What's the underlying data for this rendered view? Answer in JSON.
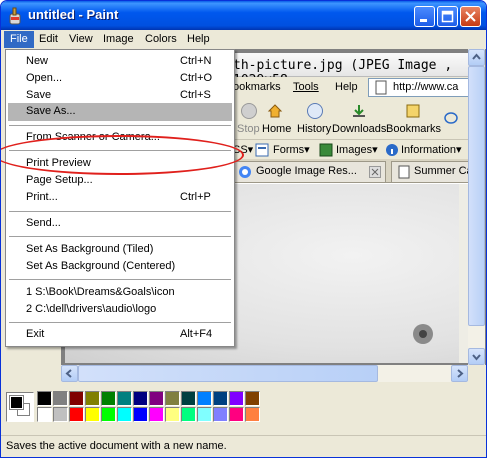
{
  "window": {
    "title": "untitled - Paint"
  },
  "menubar": [
    "File",
    "Edit",
    "View",
    "Image",
    "Colors",
    "Help"
  ],
  "file_menu": {
    "items": [
      {
        "label": "New",
        "shortcut": "Ctrl+N"
      },
      {
        "label": "Open...",
        "shortcut": "Ctrl+O"
      },
      {
        "label": "Save",
        "shortcut": "Ctrl+S"
      },
      {
        "label": "Save As...",
        "shortcut": ""
      },
      {
        "label": "From Scanner or Camera...",
        "shortcut": ""
      },
      {
        "label": "Print Preview",
        "shortcut": ""
      },
      {
        "label": "Page Setup...",
        "shortcut": ""
      },
      {
        "label": "Print...",
        "shortcut": "Ctrl+P"
      },
      {
        "label": "Send...",
        "shortcut": ""
      },
      {
        "label": "Set As Background (Tiled)",
        "shortcut": ""
      },
      {
        "label": "Set As Background (Centered)",
        "shortcut": ""
      },
      {
        "label": "1 S:\\Book\\Dreams&Goals\\icon",
        "shortcut": ""
      },
      {
        "label": "2 C:\\dell\\drivers\\audio\\logo",
        "shortcut": ""
      },
      {
        "label": "Exit",
        "shortcut": "Alt+F4"
      }
    ],
    "highlighted": "Save As..."
  },
  "picture": {
    "title": "th-picture.jpg (JPEG Image , 1029x58",
    "menu": {
      "bookmarks": "ookmarks",
      "tools": "Tools",
      "help": "Help"
    },
    "url": "http://www.ca",
    "toolbar": {
      "stop": "Stop",
      "home": "Home",
      "history": "History",
      "downloads": "Downloads",
      "bookmarks": "Bookmarks"
    },
    "extras": {
      "ss": "SS▾",
      "forms": "Forms▾",
      "images": "Images▾",
      "information": "Information▾"
    },
    "tabs": [
      "Google Image Res...",
      "Summer Ca"
    ]
  },
  "palette": {
    "top_row": [
      "#000000",
      "#808080",
      "#800000",
      "#808000",
      "#008000",
      "#008080",
      "#000080",
      "#800080",
      "#808040",
      "#004040",
      "#0080ff",
      "#004080",
      "#8000ff",
      "#804000"
    ],
    "bottom_row": [
      "#ffffff",
      "#c0c0c0",
      "#ff0000",
      "#ffff00",
      "#00ff00",
      "#00ffff",
      "#0000ff",
      "#ff00ff",
      "#ffff80",
      "#00ff80",
      "#80ffff",
      "#8080ff",
      "#ff0080",
      "#ff8040"
    ]
  },
  "status": "Saves the active document with a new name."
}
